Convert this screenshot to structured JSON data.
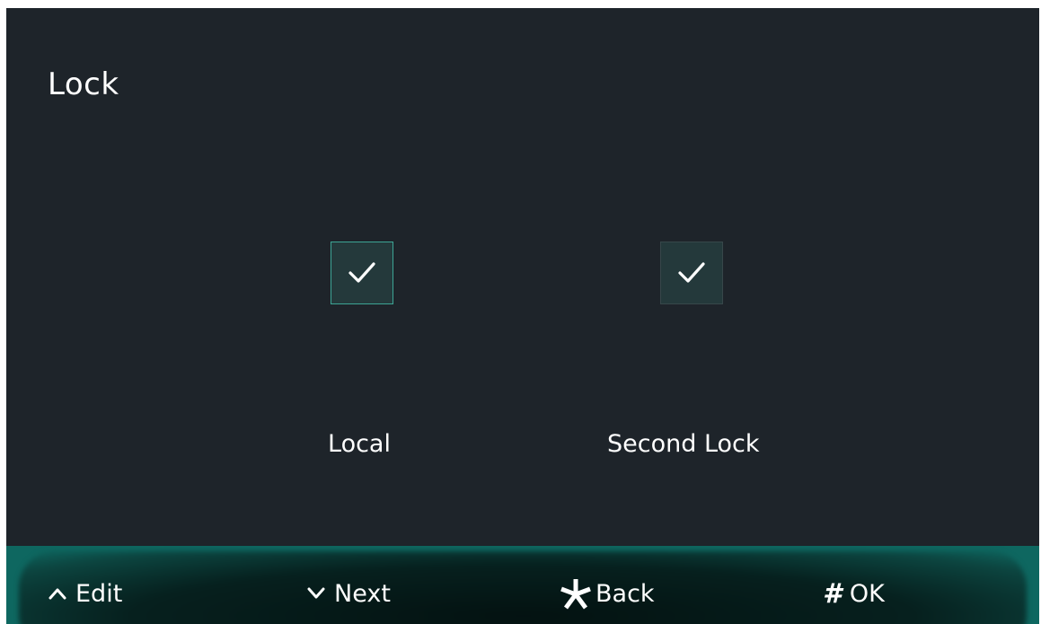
{
  "header": {
    "title": "Lock"
  },
  "options": [
    {
      "label": "Local",
      "checked": true,
      "focused": true
    },
    {
      "label": "Second Lock",
      "checked": true,
      "focused": false
    }
  ],
  "footer": {
    "edit": {
      "icon": "caret-up-icon",
      "label": "Edit"
    },
    "next": {
      "icon": "caret-down-icon",
      "label": "Next"
    },
    "back": {
      "icon": "asterisk-icon",
      "label": "Back"
    },
    "ok": {
      "icon": "hash-icon",
      "glyph": "#",
      "label": "OK"
    }
  },
  "colors": {
    "background": "#1e242a",
    "accent": "#3da595",
    "footer": "#0e6760",
    "checkbox_fill": "#24393b"
  }
}
